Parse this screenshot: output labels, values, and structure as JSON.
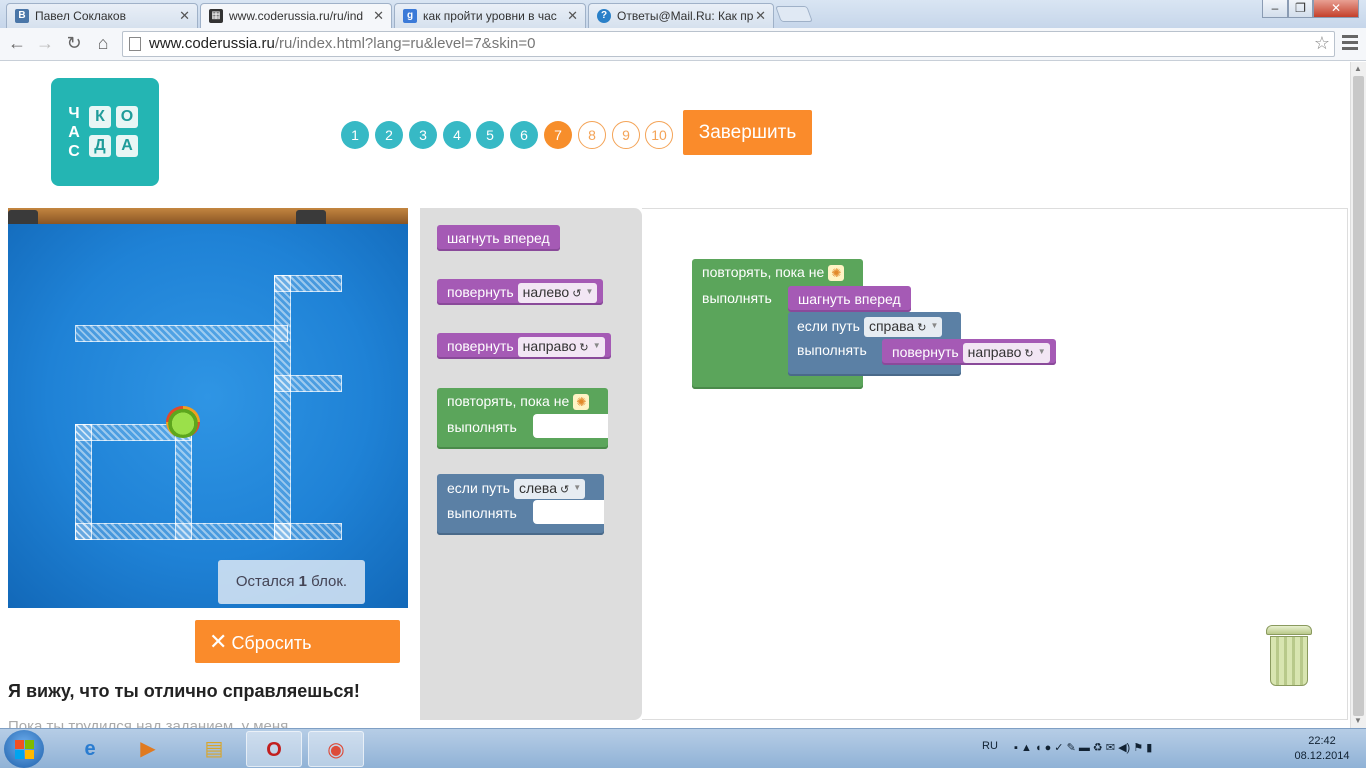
{
  "browser": {
    "tabs": [
      {
        "title": "Павел Соклаков",
        "favicon_text": "B",
        "favicon_color": "#4a76a8"
      },
      {
        "title": "www.coderussia.ru/ru/ind",
        "favicon_text": "▦",
        "favicon_color": "#333333"
      },
      {
        "title": "как пройти уровни в час",
        "favicon_text": "g",
        "favicon_color": "#3b7ad8"
      },
      {
        "title": "Ответы@Mail.Ru: Как пр",
        "favicon_text": "?",
        "favicon_color": "#2a80c8"
      }
    ],
    "active_tab": 1,
    "url_host": "www.coderussia.ru",
    "url_path": "/ru/index.html?lang=ru&level=7&skin=0"
  },
  "logo": {
    "vertical": [
      "Ч",
      "А",
      "С"
    ],
    "tiles": [
      "К",
      "О",
      "Д",
      "А"
    ]
  },
  "levels": [
    "1",
    "2",
    "3",
    "4",
    "5",
    "6",
    "7",
    "8",
    "9",
    "10"
  ],
  "current_level": 7,
  "finish_label": "Завершить",
  "game": {
    "blocks_left_prefix": "Остался",
    "blocks_left_count": "1",
    "blocks_left_suffix": "блок."
  },
  "reset_label": "Сбросить",
  "hint": {
    "title": "Я вижу, что ты отлично справляешься!",
    "text": "Пока ты трудился над заданием, у меня"
  },
  "toolbox": {
    "move_forward": "шагнуть вперед",
    "turn_label": "повернуть",
    "left_option": "налево",
    "right_option": "направо",
    "repeat_until": "повторять, пока не",
    "do_label": "выполнять",
    "if_path": "если путь",
    "left_path_option": "слева"
  },
  "workspace": {
    "repeat_until": "повторять, пока не",
    "do_label": "выполнять",
    "move_forward": "шагнуть вперед",
    "if_path": "если путь",
    "right_path_option": "справа",
    "do_label_inner": "выполнять",
    "turn_label": "повернуть",
    "turn_option": "направо"
  },
  "taskbar": {
    "lang": "RU",
    "time": "22:42",
    "date": "08.12.2014"
  },
  "colors": {
    "accent_orange": "#fa8b2b",
    "level_done": "#37b9c5",
    "block_purple": "#a55ab5",
    "block_green": "#5ba55b",
    "block_slate": "#5b80a5"
  }
}
